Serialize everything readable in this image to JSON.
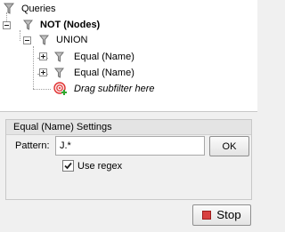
{
  "tree": {
    "root_label": "Queries",
    "not_label": "NOT (Nodes)",
    "union_label": "UNION",
    "children": [
      {
        "label": "Equal (Name)"
      },
      {
        "label": "Equal (Name)"
      }
    ],
    "drag_hint": "Drag subfilter here"
  },
  "settings": {
    "title": "Equal (Name) Settings",
    "pattern_label": "Pattern:",
    "pattern_value": "J.*",
    "ok_label": "OK",
    "use_regex_label": "Use regex",
    "use_regex_checked": true
  },
  "footer": {
    "stop_label": "Stop"
  },
  "colors": {
    "filter_icon": "#8a8a8a",
    "stop_red": "#d84040",
    "target_red": "#e03030",
    "target_plus_green": "#2fa82f"
  }
}
